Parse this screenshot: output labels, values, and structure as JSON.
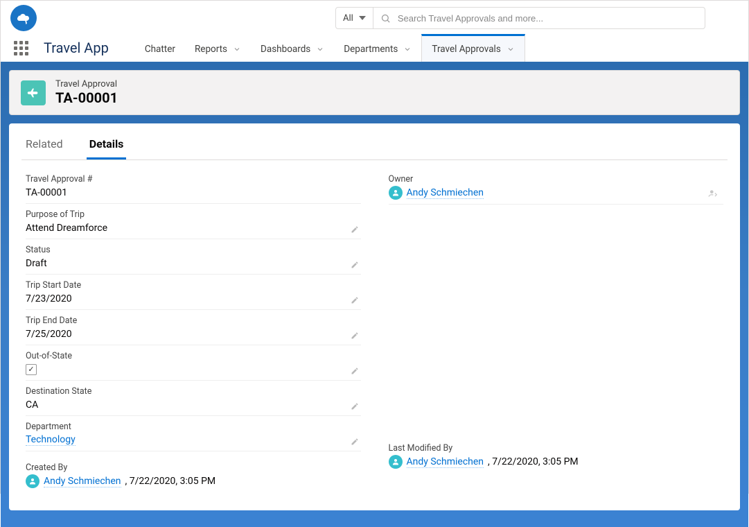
{
  "app_name": "Travel App",
  "search": {
    "scope": "All",
    "placeholder": "Search Travel Approvals and more..."
  },
  "nav": [
    {
      "label": "Chatter",
      "dropdown": false,
      "active": false
    },
    {
      "label": "Reports",
      "dropdown": true,
      "active": false
    },
    {
      "label": "Dashboards",
      "dropdown": true,
      "active": false
    },
    {
      "label": "Departments",
      "dropdown": true,
      "active": false
    },
    {
      "label": "Travel Approvals",
      "dropdown": true,
      "active": true
    }
  ],
  "header": {
    "object_label": "Travel Approval",
    "record_title": "TA-00001"
  },
  "tabs": [
    {
      "label": "Related",
      "active": false
    },
    {
      "label": "Details",
      "active": true
    }
  ],
  "fields": {
    "number_label": "Travel Approval #",
    "number_value": "TA-00001",
    "owner_label": "Owner",
    "owner_value": "Andy Schmiechen",
    "purpose_label": "Purpose of Trip",
    "purpose_value": "Attend Dreamforce",
    "status_label": "Status",
    "status_value": "Draft",
    "start_label": "Trip Start Date",
    "start_value": "7/23/2020",
    "end_label": "Trip End Date",
    "end_value": "7/25/2020",
    "oos_label": "Out-of-State",
    "oos_checked": true,
    "dest_label": "Destination State",
    "dest_value": "CA",
    "dept_label": "Department",
    "dept_value": "Technology",
    "created_label": "Created By",
    "created_name": "Andy Schmiechen",
    "created_date": ", 7/22/2020, 3:05 PM",
    "modified_label": "Last Modified By",
    "modified_name": "Andy Schmiechen",
    "modified_date": ", 7/22/2020, 3:05 PM"
  }
}
